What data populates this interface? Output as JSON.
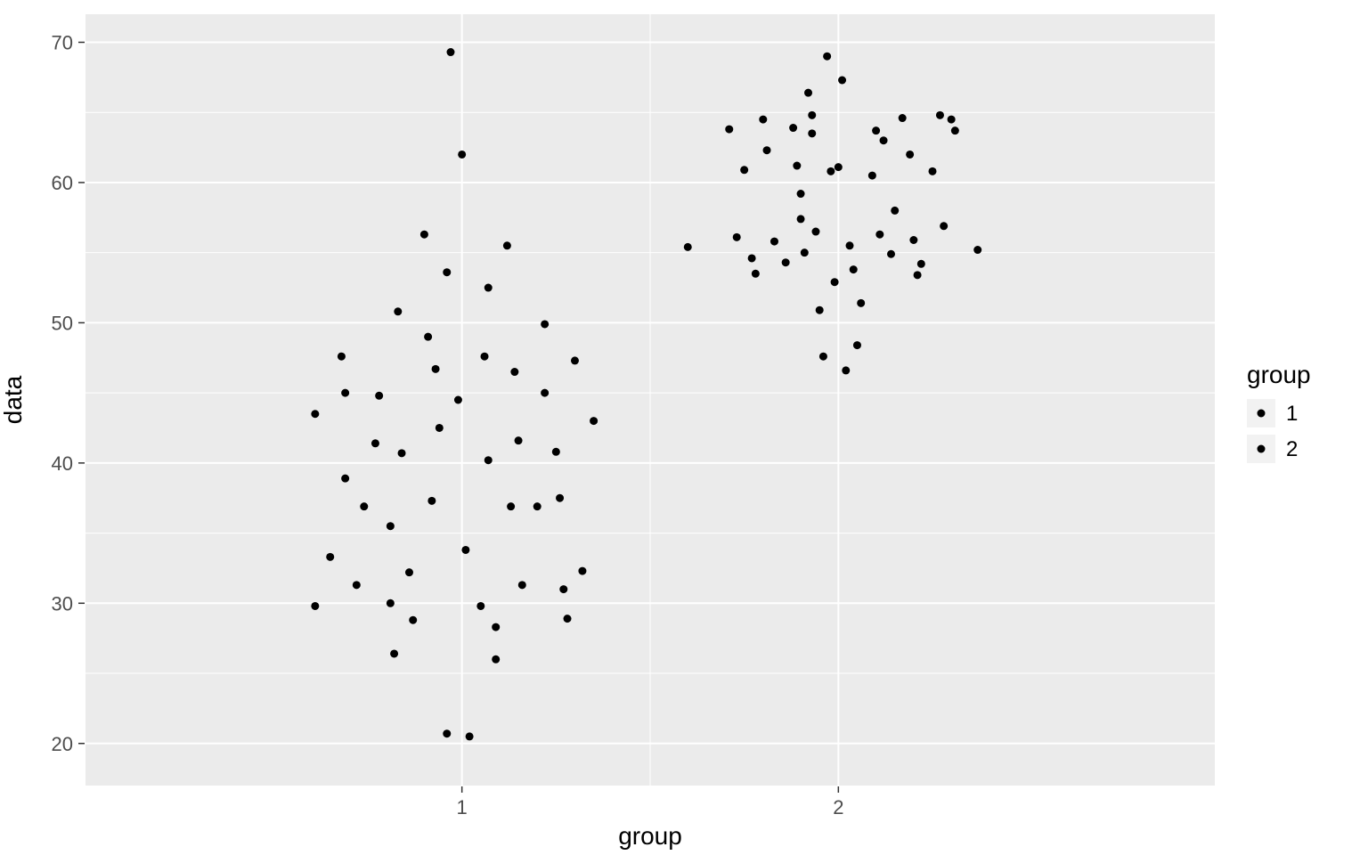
{
  "chart_data": {
    "type": "scatter",
    "xlabel": "group",
    "ylabel": "data",
    "x_categories": [
      "1",
      "2"
    ],
    "y_ticks": [
      20,
      30,
      40,
      50,
      60,
      70
    ],
    "ylim": [
      17,
      72
    ],
    "jitter_width": 0.4,
    "legend": {
      "title": "group",
      "entries": [
        "1",
        "2"
      ]
    },
    "series": [
      {
        "name": "1",
        "x_category": "1",
        "points": [
          {
            "jx": -0.39,
            "y": 43.5
          },
          {
            "jx": -0.39,
            "y": 29.8
          },
          {
            "jx": -0.35,
            "y": 33.3
          },
          {
            "jx": -0.32,
            "y": 47.6
          },
          {
            "jx": -0.31,
            "y": 45.0
          },
          {
            "jx": -0.31,
            "y": 38.9
          },
          {
            "jx": -0.28,
            "y": 31.3
          },
          {
            "jx": -0.26,
            "y": 36.9
          },
          {
            "jx": -0.23,
            "y": 41.4
          },
          {
            "jx": -0.22,
            "y": 44.8
          },
          {
            "jx": -0.19,
            "y": 30.0
          },
          {
            "jx": -0.19,
            "y": 35.5
          },
          {
            "jx": -0.18,
            "y": 26.4
          },
          {
            "jx": -0.17,
            "y": 50.8
          },
          {
            "jx": -0.16,
            "y": 40.7
          },
          {
            "jx": -0.14,
            "y": 32.2
          },
          {
            "jx": -0.13,
            "y": 28.8
          },
          {
            "jx": -0.1,
            "y": 56.3
          },
          {
            "jx": -0.09,
            "y": 49.0
          },
          {
            "jx": -0.08,
            "y": 37.3
          },
          {
            "jx": -0.07,
            "y": 46.7
          },
          {
            "jx": -0.06,
            "y": 42.5
          },
          {
            "jx": -0.04,
            "y": 53.6
          },
          {
            "jx": -0.04,
            "y": 20.7
          },
          {
            "jx": -0.03,
            "y": 69.3
          },
          {
            "jx": -0.01,
            "y": 44.5
          },
          {
            "jx": 0.0,
            "y": 62.0
          },
          {
            "jx": 0.01,
            "y": 33.8
          },
          {
            "jx": 0.02,
            "y": 20.5
          },
          {
            "jx": 0.05,
            "y": 29.8
          },
          {
            "jx": 0.06,
            "y": 47.6
          },
          {
            "jx": 0.07,
            "y": 40.2
          },
          {
            "jx": 0.07,
            "y": 52.5
          },
          {
            "jx": 0.09,
            "y": 28.3
          },
          {
            "jx": 0.09,
            "y": 26.0
          },
          {
            "jx": 0.12,
            "y": 55.5
          },
          {
            "jx": 0.13,
            "y": 36.9
          },
          {
            "jx": 0.14,
            "y": 46.5
          },
          {
            "jx": 0.15,
            "y": 41.6
          },
          {
            "jx": 0.16,
            "y": 31.3
          },
          {
            "jx": 0.2,
            "y": 36.9
          },
          {
            "jx": 0.22,
            "y": 45.0
          },
          {
            "jx": 0.22,
            "y": 49.9
          },
          {
            "jx": 0.25,
            "y": 40.8
          },
          {
            "jx": 0.26,
            "y": 37.5
          },
          {
            "jx": 0.27,
            "y": 31.0
          },
          {
            "jx": 0.28,
            "y": 28.9
          },
          {
            "jx": 0.3,
            "y": 47.3
          },
          {
            "jx": 0.32,
            "y": 32.3
          },
          {
            "jx": 0.35,
            "y": 43.0
          }
        ]
      },
      {
        "name": "2",
        "x_category": "2",
        "points": [
          {
            "jx": -0.4,
            "y": 55.4
          },
          {
            "jx": -0.29,
            "y": 63.8
          },
          {
            "jx": -0.27,
            "y": 56.1
          },
          {
            "jx": -0.25,
            "y": 60.9
          },
          {
            "jx": -0.23,
            "y": 54.6
          },
          {
            "jx": -0.22,
            "y": 53.5
          },
          {
            "jx": -0.2,
            "y": 64.5
          },
          {
            "jx": -0.19,
            "y": 62.3
          },
          {
            "jx": -0.17,
            "y": 55.8
          },
          {
            "jx": -0.14,
            "y": 54.3
          },
          {
            "jx": -0.12,
            "y": 63.9
          },
          {
            "jx": -0.11,
            "y": 61.2
          },
          {
            "jx": -0.1,
            "y": 59.2
          },
          {
            "jx": -0.1,
            "y": 57.4
          },
          {
            "jx": -0.09,
            "y": 55.0
          },
          {
            "jx": -0.08,
            "y": 66.4
          },
          {
            "jx": -0.07,
            "y": 64.8
          },
          {
            "jx": -0.07,
            "y": 63.5
          },
          {
            "jx": -0.06,
            "y": 56.5
          },
          {
            "jx": -0.05,
            "y": 50.9
          },
          {
            "jx": -0.04,
            "y": 47.6
          },
          {
            "jx": -0.03,
            "y": 69.0
          },
          {
            "jx": -0.02,
            "y": 60.8
          },
          {
            "jx": -0.01,
            "y": 52.9
          },
          {
            "jx": 0.0,
            "y": 61.1
          },
          {
            "jx": 0.01,
            "y": 67.3
          },
          {
            "jx": 0.02,
            "y": 46.6
          },
          {
            "jx": 0.03,
            "y": 55.5
          },
          {
            "jx": 0.04,
            "y": 53.8
          },
          {
            "jx": 0.05,
            "y": 48.4
          },
          {
            "jx": 0.06,
            "y": 51.4
          },
          {
            "jx": 0.09,
            "y": 60.5
          },
          {
            "jx": 0.1,
            "y": 63.7
          },
          {
            "jx": 0.11,
            "y": 56.3
          },
          {
            "jx": 0.12,
            "y": 63.0
          },
          {
            "jx": 0.14,
            "y": 54.9
          },
          {
            "jx": 0.15,
            "y": 58.0
          },
          {
            "jx": 0.17,
            "y": 64.6
          },
          {
            "jx": 0.19,
            "y": 62.0
          },
          {
            "jx": 0.2,
            "y": 55.9
          },
          {
            "jx": 0.21,
            "y": 53.4
          },
          {
            "jx": 0.22,
            "y": 54.2
          },
          {
            "jx": 0.25,
            "y": 60.8
          },
          {
            "jx": 0.27,
            "y": 64.8
          },
          {
            "jx": 0.28,
            "y": 56.9
          },
          {
            "jx": 0.3,
            "y": 64.5
          },
          {
            "jx": 0.31,
            "y": 63.7
          },
          {
            "jx": 0.37,
            "y": 55.2
          }
        ]
      }
    ]
  }
}
